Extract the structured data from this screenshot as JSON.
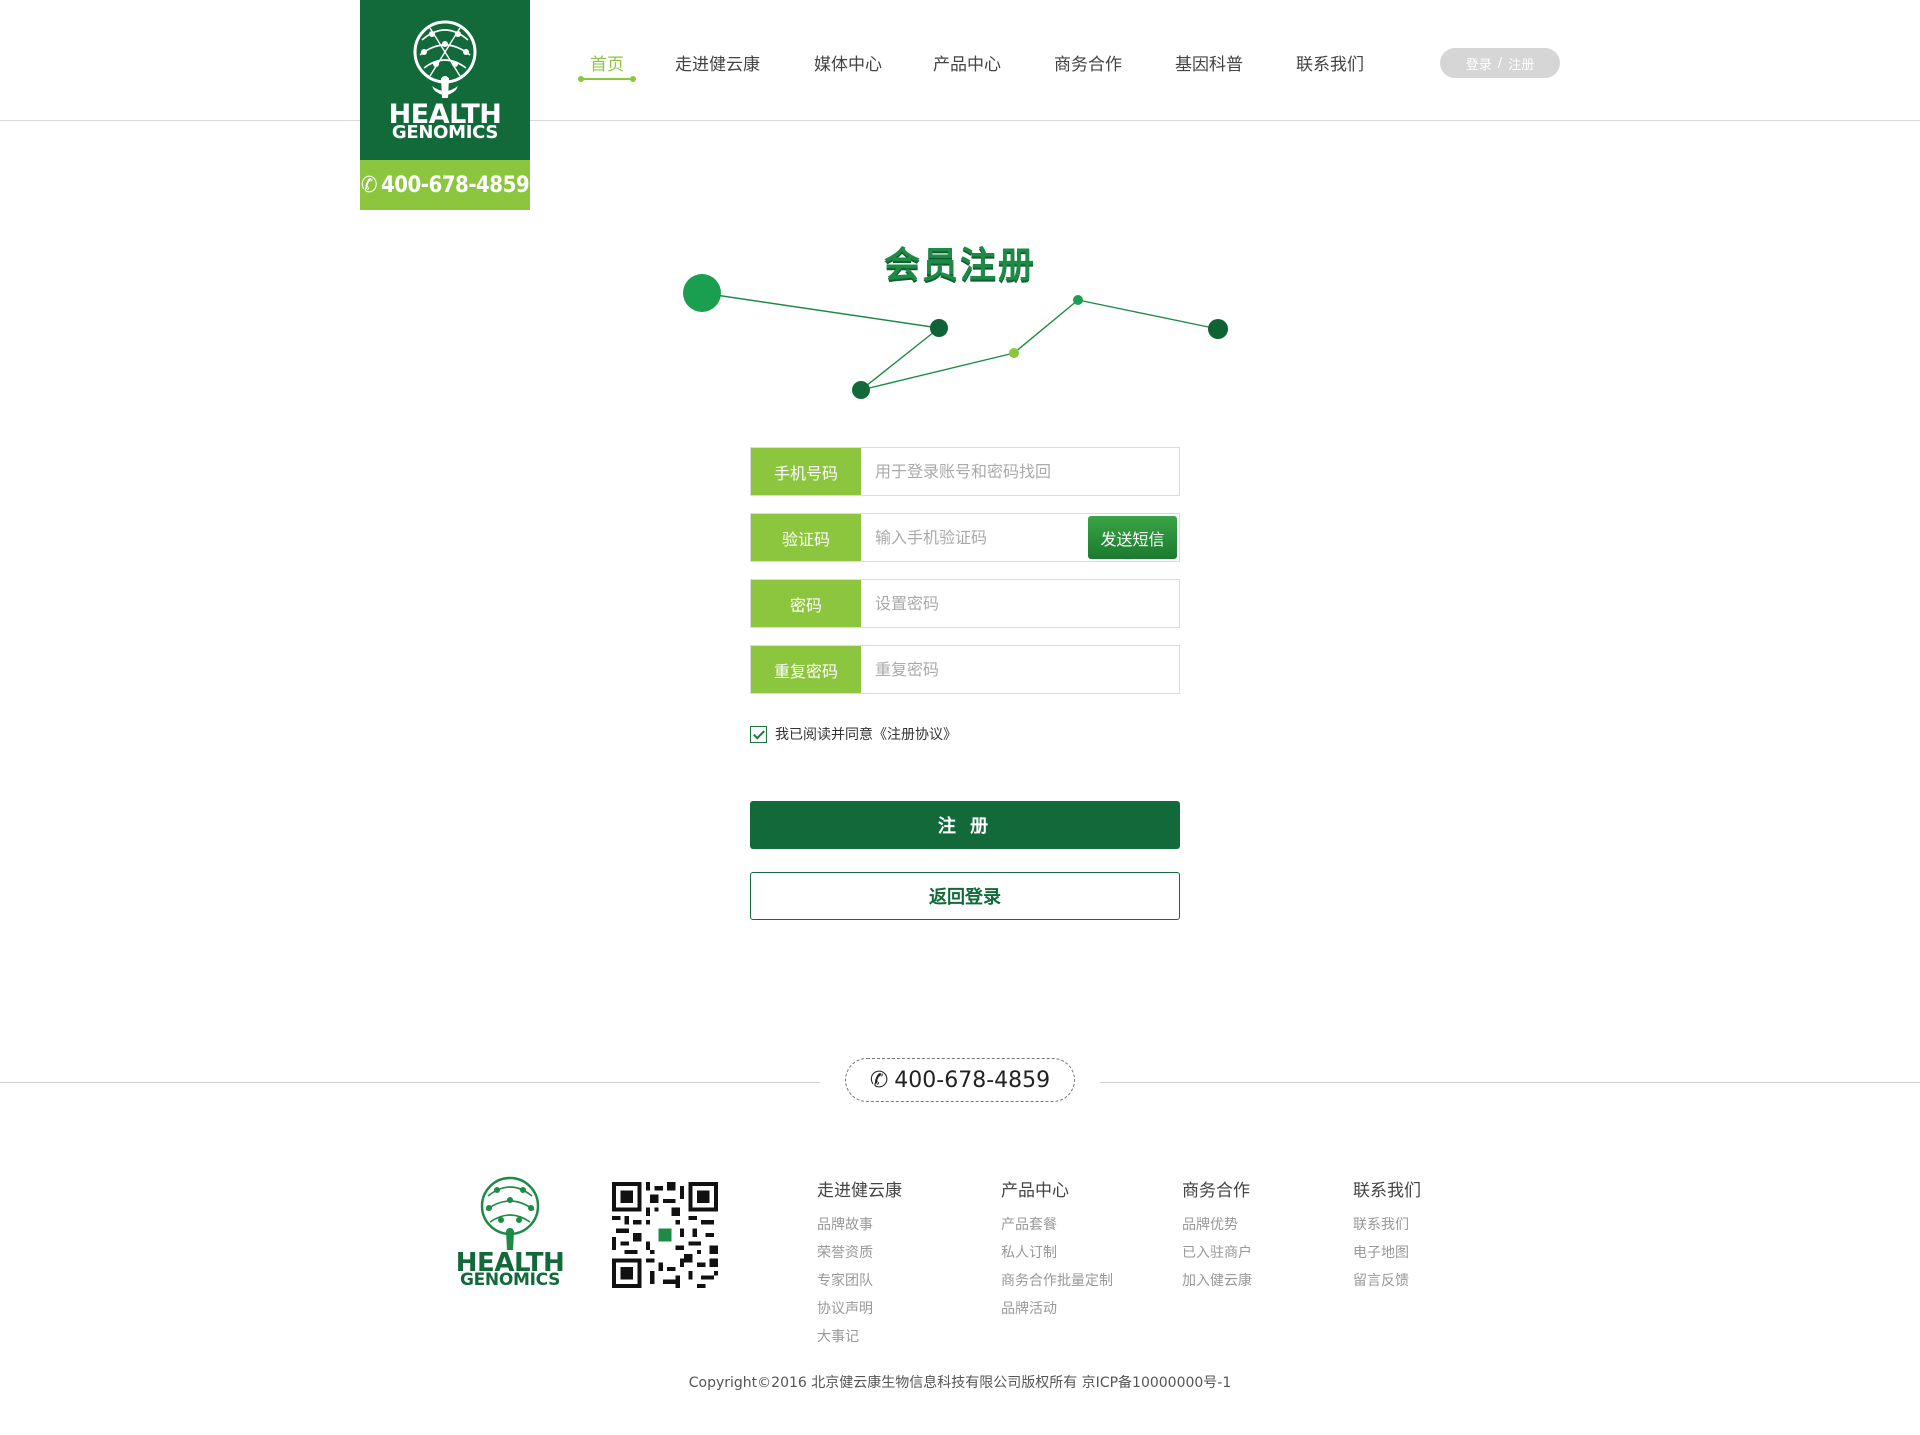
{
  "brand": {
    "logo_line1": "HEALTH",
    "logo_line2": "GENOMICS",
    "phone": "400-678-4859",
    "green_dark": "#126a3a",
    "green_light": "#8cc63f"
  },
  "nav": {
    "items": [
      {
        "label": "首页",
        "active": true
      },
      {
        "label": "走进健云康"
      },
      {
        "label": "媒体中心"
      },
      {
        "label": "产品中心"
      },
      {
        "label": "商务合作"
      },
      {
        "label": "基因科普"
      },
      {
        "label": "联系我们"
      }
    ],
    "login_label": "登录",
    "separator": "/",
    "register_label": "注册"
  },
  "page": {
    "title": "会员注册"
  },
  "form": {
    "phone_label": "手机号码",
    "phone_placeholder": "用于登录账号和密码找回",
    "code_label": "验证码",
    "code_placeholder": "输入手机验证码",
    "send_sms_label": "发送短信",
    "password_label": "密码",
    "password_placeholder": "设置密码",
    "repeat_label": "重复密码",
    "repeat_placeholder": "重复密码",
    "agree_text": "我已阅读并同意《注册协议》",
    "agree_checked": true,
    "register_button": "注 册",
    "back_button": "返回登录"
  },
  "footer": {
    "phone": "400-678-4859",
    "logo_line1": "HEALTH",
    "logo_line2": "GENOMICS",
    "columns": [
      {
        "title": "走进健云康",
        "links": [
          "品牌故事",
          "荣誉资质",
          "专家团队",
          "协议声明",
          "大事记"
        ]
      },
      {
        "title": "产品中心",
        "links": [
          "产品套餐",
          "私人订制",
          "商务合作批量定制",
          "品牌活动"
        ]
      },
      {
        "title": "商务合作",
        "links": [
          "品牌优势",
          "已入驻商户",
          "加入健云康"
        ]
      },
      {
        "title": "联系我们",
        "links": [
          "联系我们",
          "电子地图",
          "留言反馈"
        ]
      }
    ],
    "copyright": "Copyright©2016 北京健云康生物信息科技有限公司版权所有 京ICP备10000000号-1"
  }
}
